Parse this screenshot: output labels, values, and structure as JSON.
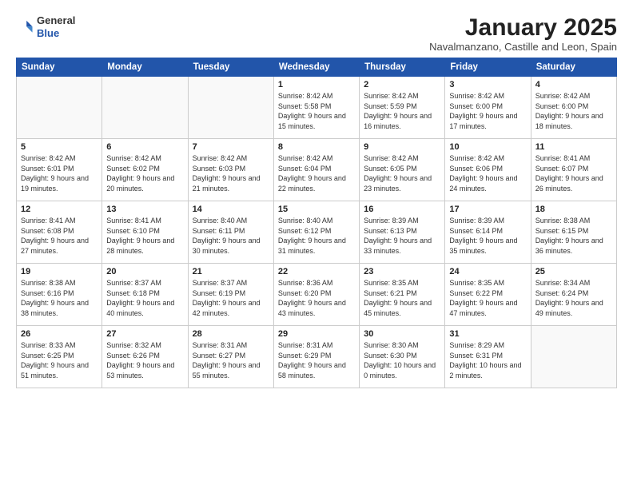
{
  "header": {
    "logo_line1": "General",
    "logo_line2": "Blue",
    "month": "January 2025",
    "location": "Navalmanzano, Castille and Leon, Spain"
  },
  "weekdays": [
    "Sunday",
    "Monday",
    "Tuesday",
    "Wednesday",
    "Thursday",
    "Friday",
    "Saturday"
  ],
  "weeks": [
    [
      {
        "day": "",
        "info": ""
      },
      {
        "day": "",
        "info": ""
      },
      {
        "day": "",
        "info": ""
      },
      {
        "day": "1",
        "info": "Sunrise: 8:42 AM\nSunset: 5:58 PM\nDaylight: 9 hours and 15 minutes."
      },
      {
        "day": "2",
        "info": "Sunrise: 8:42 AM\nSunset: 5:59 PM\nDaylight: 9 hours and 16 minutes."
      },
      {
        "day": "3",
        "info": "Sunrise: 8:42 AM\nSunset: 6:00 PM\nDaylight: 9 hours and 17 minutes."
      },
      {
        "day": "4",
        "info": "Sunrise: 8:42 AM\nSunset: 6:00 PM\nDaylight: 9 hours and 18 minutes."
      }
    ],
    [
      {
        "day": "5",
        "info": "Sunrise: 8:42 AM\nSunset: 6:01 PM\nDaylight: 9 hours and 19 minutes."
      },
      {
        "day": "6",
        "info": "Sunrise: 8:42 AM\nSunset: 6:02 PM\nDaylight: 9 hours and 20 minutes."
      },
      {
        "day": "7",
        "info": "Sunrise: 8:42 AM\nSunset: 6:03 PM\nDaylight: 9 hours and 21 minutes."
      },
      {
        "day": "8",
        "info": "Sunrise: 8:42 AM\nSunset: 6:04 PM\nDaylight: 9 hours and 22 minutes."
      },
      {
        "day": "9",
        "info": "Sunrise: 8:42 AM\nSunset: 6:05 PM\nDaylight: 9 hours and 23 minutes."
      },
      {
        "day": "10",
        "info": "Sunrise: 8:42 AM\nSunset: 6:06 PM\nDaylight: 9 hours and 24 minutes."
      },
      {
        "day": "11",
        "info": "Sunrise: 8:41 AM\nSunset: 6:07 PM\nDaylight: 9 hours and 26 minutes."
      }
    ],
    [
      {
        "day": "12",
        "info": "Sunrise: 8:41 AM\nSunset: 6:08 PM\nDaylight: 9 hours and 27 minutes."
      },
      {
        "day": "13",
        "info": "Sunrise: 8:41 AM\nSunset: 6:10 PM\nDaylight: 9 hours and 28 minutes."
      },
      {
        "day": "14",
        "info": "Sunrise: 8:40 AM\nSunset: 6:11 PM\nDaylight: 9 hours and 30 minutes."
      },
      {
        "day": "15",
        "info": "Sunrise: 8:40 AM\nSunset: 6:12 PM\nDaylight: 9 hours and 31 minutes."
      },
      {
        "day": "16",
        "info": "Sunrise: 8:39 AM\nSunset: 6:13 PM\nDaylight: 9 hours and 33 minutes."
      },
      {
        "day": "17",
        "info": "Sunrise: 8:39 AM\nSunset: 6:14 PM\nDaylight: 9 hours and 35 minutes."
      },
      {
        "day": "18",
        "info": "Sunrise: 8:38 AM\nSunset: 6:15 PM\nDaylight: 9 hours and 36 minutes."
      }
    ],
    [
      {
        "day": "19",
        "info": "Sunrise: 8:38 AM\nSunset: 6:16 PM\nDaylight: 9 hours and 38 minutes."
      },
      {
        "day": "20",
        "info": "Sunrise: 8:37 AM\nSunset: 6:18 PM\nDaylight: 9 hours and 40 minutes."
      },
      {
        "day": "21",
        "info": "Sunrise: 8:37 AM\nSunset: 6:19 PM\nDaylight: 9 hours and 42 minutes."
      },
      {
        "day": "22",
        "info": "Sunrise: 8:36 AM\nSunset: 6:20 PM\nDaylight: 9 hours and 43 minutes."
      },
      {
        "day": "23",
        "info": "Sunrise: 8:35 AM\nSunset: 6:21 PM\nDaylight: 9 hours and 45 minutes."
      },
      {
        "day": "24",
        "info": "Sunrise: 8:35 AM\nSunset: 6:22 PM\nDaylight: 9 hours and 47 minutes."
      },
      {
        "day": "25",
        "info": "Sunrise: 8:34 AM\nSunset: 6:24 PM\nDaylight: 9 hours and 49 minutes."
      }
    ],
    [
      {
        "day": "26",
        "info": "Sunrise: 8:33 AM\nSunset: 6:25 PM\nDaylight: 9 hours and 51 minutes."
      },
      {
        "day": "27",
        "info": "Sunrise: 8:32 AM\nSunset: 6:26 PM\nDaylight: 9 hours and 53 minutes."
      },
      {
        "day": "28",
        "info": "Sunrise: 8:31 AM\nSunset: 6:27 PM\nDaylight: 9 hours and 55 minutes."
      },
      {
        "day": "29",
        "info": "Sunrise: 8:31 AM\nSunset: 6:29 PM\nDaylight: 9 hours and 58 minutes."
      },
      {
        "day": "30",
        "info": "Sunrise: 8:30 AM\nSunset: 6:30 PM\nDaylight: 10 hours and 0 minutes."
      },
      {
        "day": "31",
        "info": "Sunrise: 8:29 AM\nSunset: 6:31 PM\nDaylight: 10 hours and 2 minutes."
      },
      {
        "day": "",
        "info": ""
      }
    ]
  ]
}
